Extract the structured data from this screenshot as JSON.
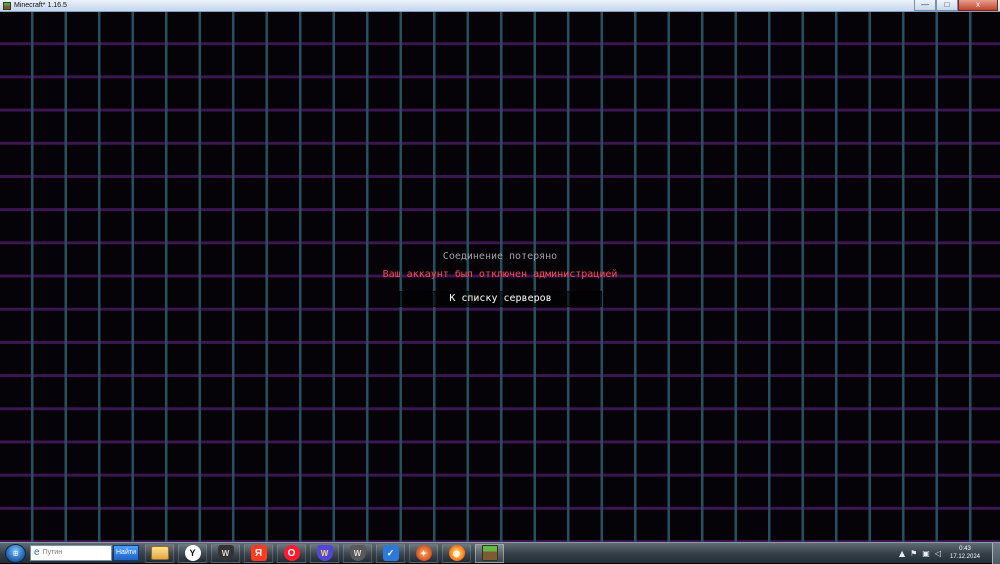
{
  "window": {
    "title": "Minecraft* 1.16.5",
    "minimize_glyph": "—",
    "restore_glyph": "□",
    "close_glyph": "x"
  },
  "screen": {
    "title": "Соединение потеряно",
    "reason": "Ваш аккаунт был отключен администрацией",
    "button_label": "К списку серверов"
  },
  "taskbar": {
    "search_logo": "e",
    "search_placeholder": "Путин",
    "find_button": "Найти",
    "apps": [
      {
        "name": "file-explorer",
        "glyph": ""
      },
      {
        "name": "yandex-browser",
        "glyph": "Y"
      },
      {
        "name": "world-of-tanks",
        "glyph": "W"
      },
      {
        "name": "yandex",
        "glyph": "Я"
      },
      {
        "name": "opera",
        "glyph": "O"
      },
      {
        "name": "warplanes",
        "glyph": "W"
      },
      {
        "name": "world-of-warships",
        "glyph": "W"
      },
      {
        "name": "security",
        "glyph": "✓"
      },
      {
        "name": "mascot-app",
        "glyph": "✦"
      },
      {
        "name": "saucer-app",
        "glyph": "◉"
      },
      {
        "name": "minecraft",
        "glyph": ""
      }
    ],
    "tray": {
      "up_arrow": "▲",
      "flag": "⚑",
      "network": "▣",
      "volume": "◁",
      "time": "0:43",
      "date": "17.12.2024"
    }
  },
  "colors": {
    "grid_background": "#050307",
    "grid_vertical": "#245160",
    "grid_horizontal": "#3c1652",
    "title_text": "#a0a0a0",
    "reason_text": "#ff4b4b"
  }
}
